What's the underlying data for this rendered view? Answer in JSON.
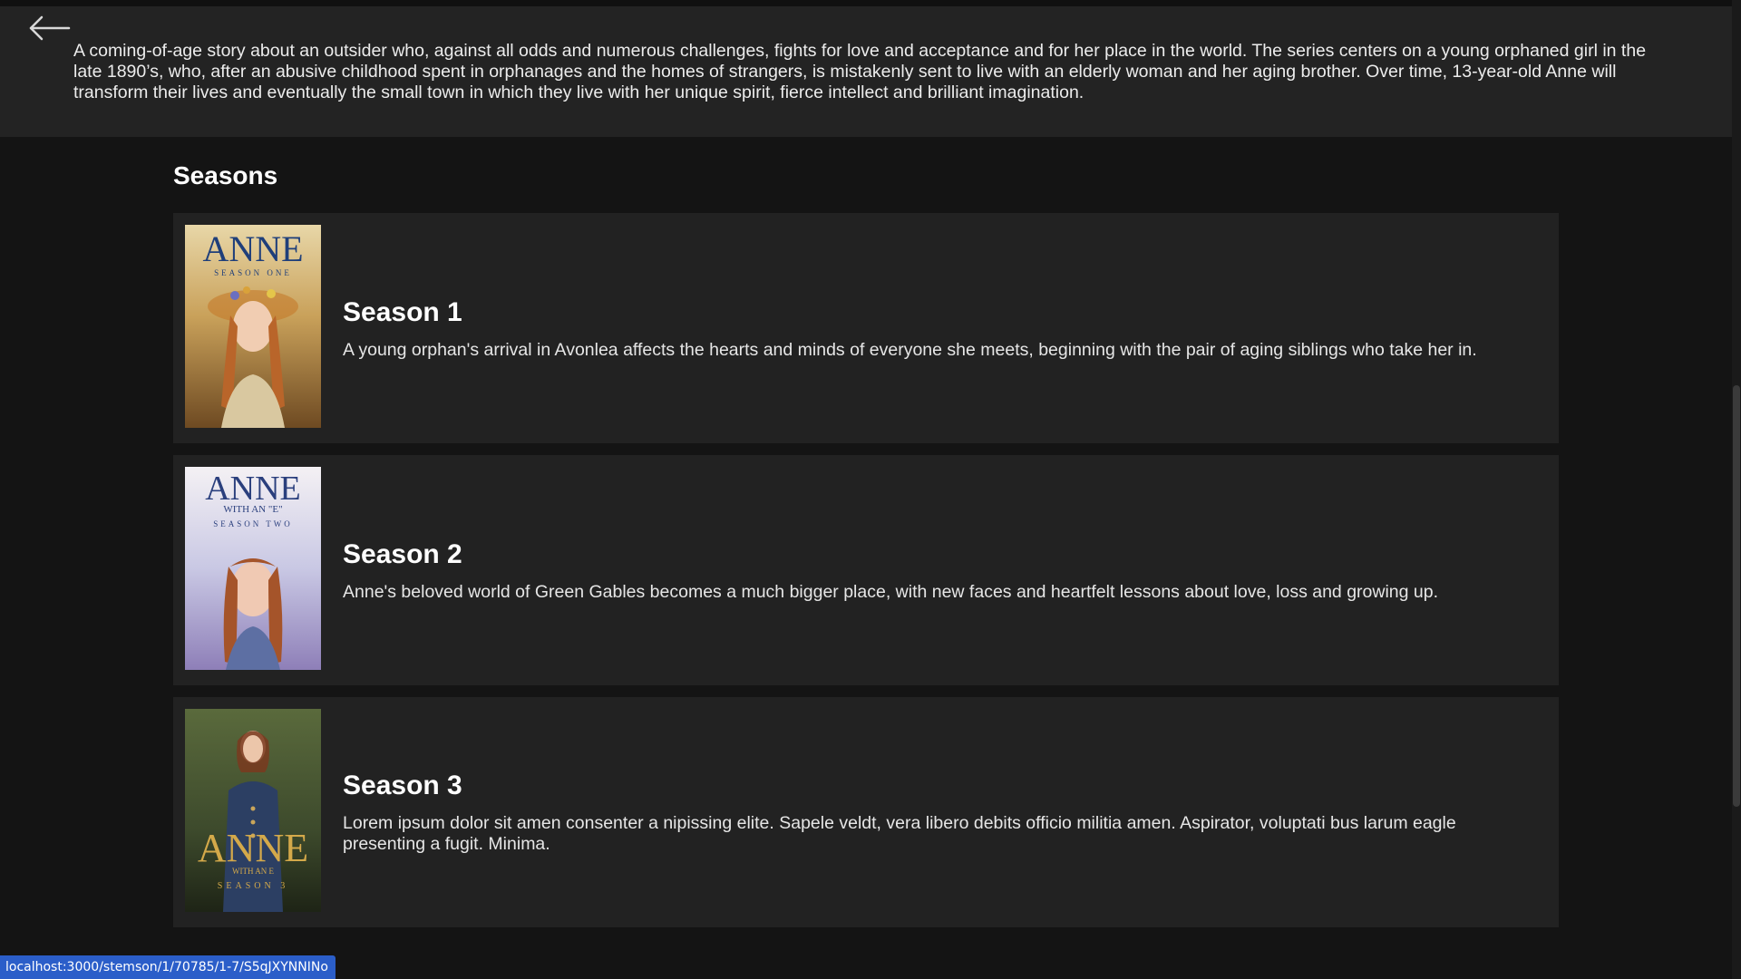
{
  "header": {
    "back_icon": "arrow-left-icon",
    "synopsis": "A coming-of-age story about an outsider who, against all odds and numerous challenges, fights for love and acceptance and for her place in the world. The series centers on a young orphaned girl in the late 1890’s, who, after an abusive childhood spent in orphanages and the homes of strangers, is mistakenly sent to live with an elderly woman and her aging brother. Over time, 13-year-old Anne will transform their lives and eventually the small town in which they live with her unique spirit, fierce intellect and brilliant imagination."
  },
  "seasons": {
    "heading": "Seasons",
    "items": [
      {
        "title": "Season 1",
        "description": "A young orphan's arrival in Avonlea affects the hearts and minds of everyone she meets, beginning with the pair of aging siblings who take her in.",
        "poster": {
          "title_text": "ANNE",
          "subtitle_text": "SEASON ONE",
          "title_color": "#1f3f7a",
          "background": "#c9a15a"
        }
      },
      {
        "title": "Season 2",
        "description": "Anne's beloved world of Green Gables becomes a much bigger place, with new faces and heartfelt lessons about love, loss and growing up.",
        "poster": {
          "title_text": "ANNE",
          "with_text": "WITH AN \"E\"",
          "subtitle_text": "SEASON TWO",
          "title_color": "#2a3f7d",
          "background": "#c9c8e4"
        }
      },
      {
        "title": "Season 3",
        "description": "Lorem ipsum dolor sit amen consenter a nipissing elite. Sapele veldt, vera libero debits officio militia amen. Aspirator, voluptati bus larum eagle presenting a fugit. Minima.",
        "poster": {
          "title_text": "ANNE",
          "with_text": "WITH AN E",
          "subtitle_text": "SEASON 3",
          "title_color": "#d4a94a",
          "background": "#3d4a2c"
        }
      }
    ]
  },
  "status_bar": {
    "url": "localhost:3000/stemson/1/70785/1-7/S5qJXYNNINo"
  },
  "colors": {
    "page_background": "#141414",
    "header_background": "#232323",
    "card_background": "#222222",
    "status_bar_background": "#2b5ec9"
  }
}
